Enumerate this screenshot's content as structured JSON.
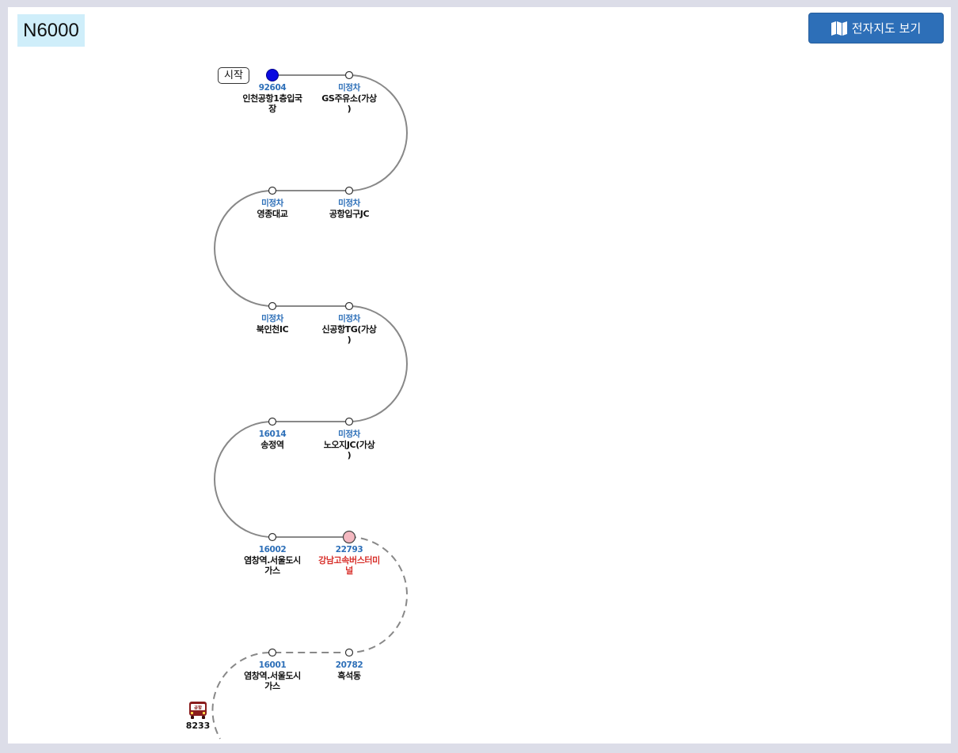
{
  "route": {
    "number": "N6000"
  },
  "toolbar": {
    "map_button_label": "전자지도 보기",
    "map_icon": "map-icon"
  },
  "start_label": "시작",
  "stops": [
    {
      "id": "92604",
      "name": "인천공항1층입국\n장",
      "status": "start"
    },
    {
      "id": "미정차",
      "name": "GS주유소(가상\n)",
      "status": "passed"
    },
    {
      "id": "미정차",
      "name": "공항입구JC",
      "status": "passed"
    },
    {
      "id": "미정차",
      "name": "영종대교",
      "status": "passed"
    },
    {
      "id": "미정차",
      "name": "북인천IC",
      "status": "passed"
    },
    {
      "id": "미정차",
      "name": "신공항TG(가상\n)",
      "status": "passed"
    },
    {
      "id": "16014",
      "name": "송정역",
      "status": "passed"
    },
    {
      "id": "미정차",
      "name": "노오지JC(가상\n)",
      "status": "passed"
    },
    {
      "id": "16002",
      "name": "염창역.서울도시\n가스",
      "status": "passed"
    },
    {
      "id": "22793",
      "name": "강남고속버스터미\n널",
      "status": "current"
    },
    {
      "id": "20782",
      "name": "흑석동",
      "status": "upcoming"
    },
    {
      "id": "16001",
      "name": "염창역.서울도시\n가스",
      "status": "upcoming"
    }
  ],
  "bus": {
    "number": "8233",
    "badge": "공항",
    "icon": "bus-icon"
  },
  "colors": {
    "accent": "#2d6fb8",
    "start_dot": "#0a0ae0",
    "current_dot": "#f4b8c0",
    "current_name": "#d8312c",
    "line": "#888888",
    "bus": "#8a1c1c"
  }
}
